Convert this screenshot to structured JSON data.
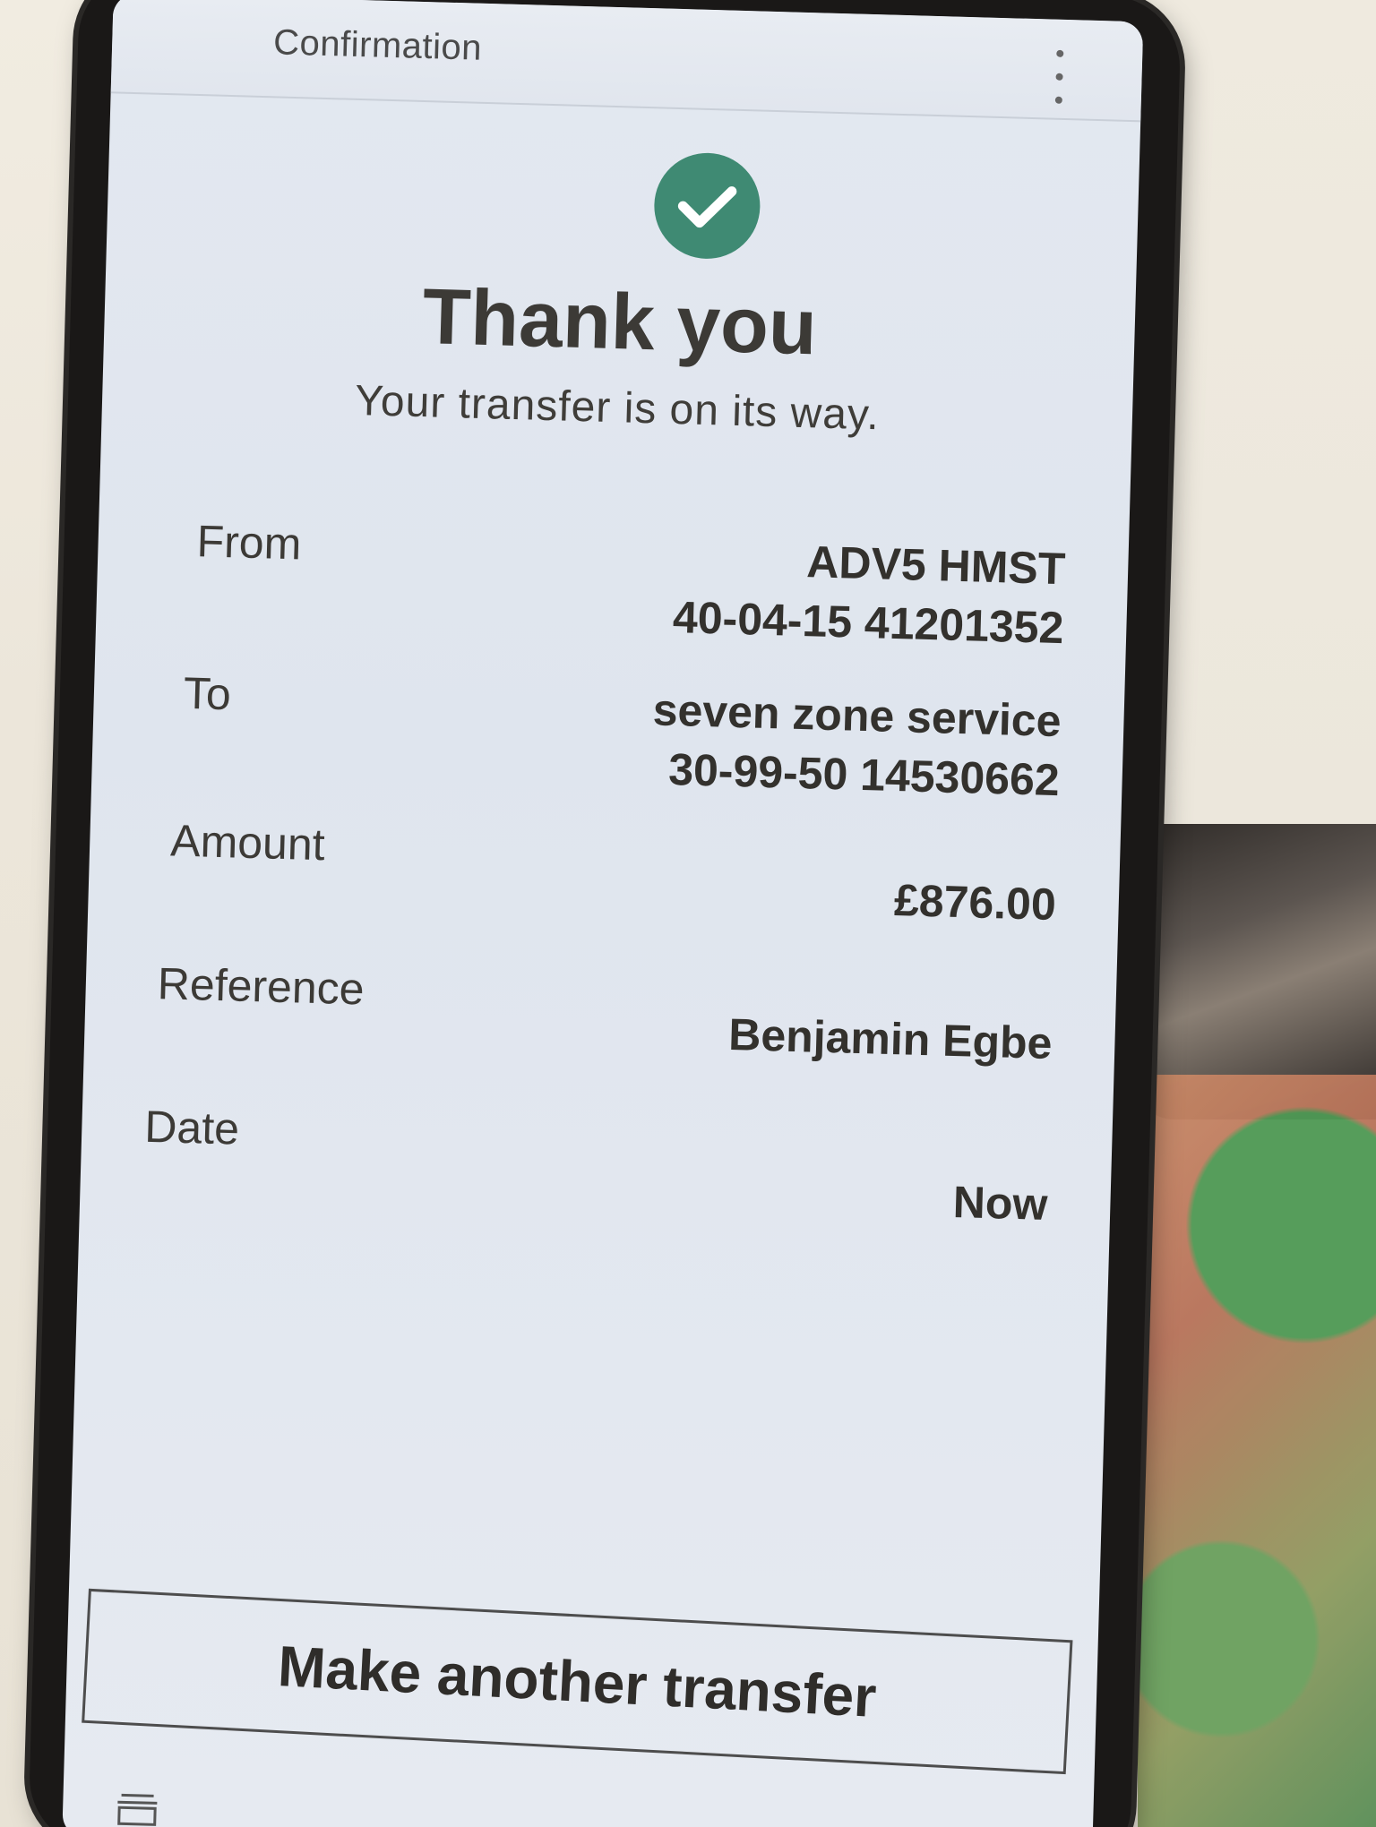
{
  "header": {
    "title": "Confirmation"
  },
  "confirmation": {
    "title": "Thank you",
    "subtitle": "Your transfer is on its way."
  },
  "details": {
    "from": {
      "label": "From",
      "name": "ADV5 HMST",
      "account": "40-04-15 41201352"
    },
    "to": {
      "label": "To",
      "name": "seven zone service",
      "account": "30-99-50 14530662"
    },
    "amount": {
      "label": "Amount",
      "value": "£876.00"
    },
    "reference": {
      "label": "Reference",
      "value": "Benjamin Egbe"
    },
    "date": {
      "label": "Date",
      "value": "Now"
    }
  },
  "actions": {
    "make_another_label": "Make another transfer"
  },
  "icons": {
    "success": "check-circle-icon",
    "more": "more-vertical-icon",
    "bottom": "bank-icon"
  },
  "colors": {
    "success": "#3f8a73"
  }
}
